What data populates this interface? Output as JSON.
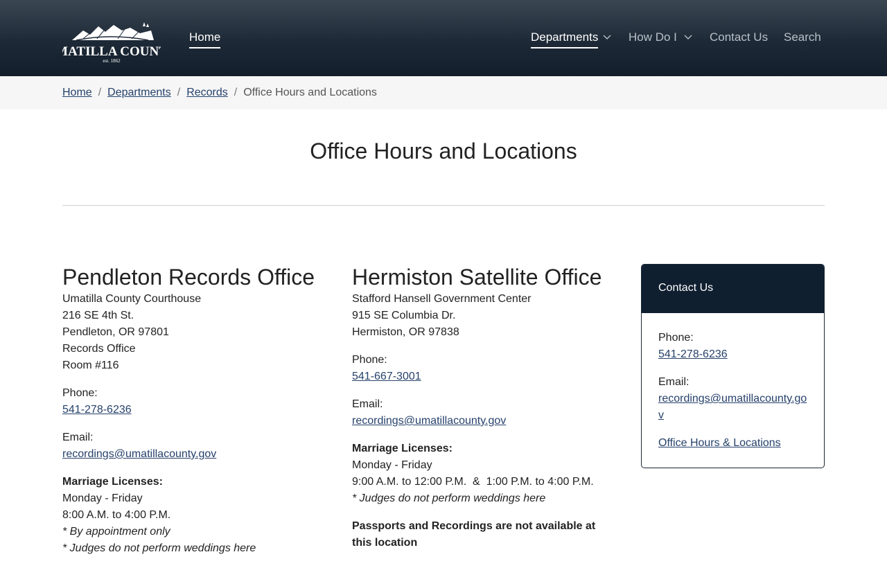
{
  "header": {
    "logo": {
      "name": "UMATILLA COUNTY",
      "est": "est. 1862"
    },
    "nav": {
      "home": "Home",
      "departments": "Departments",
      "how_do_i": "How Do I",
      "contact_us": "Contact Us",
      "search": "Search"
    }
  },
  "breadcrumb": {
    "items": [
      "Home",
      "Departments",
      "Records"
    ],
    "separator": "/",
    "current": "Office Hours and Locations"
  },
  "page": {
    "title": "Office Hours and Locations"
  },
  "pendleton": {
    "heading": "Pendleton Records Office",
    "address": [
      "Umatilla County Courthouse",
      "216 SE 4th St.",
      "Pendleton, OR 97801",
      "Records Office",
      "Room #116"
    ],
    "phone_label": "Phone:",
    "phone": "541-278-6236",
    "email_label": "Email:",
    "email": "recordings@umatillacounty.gov",
    "marriage_label": "Marriage Licenses:",
    "days": "Monday - Friday",
    "hours": "8:00 A.M. to 4:00 P.M.",
    "note1": "* By appointment only",
    "note2": "* Judges do not perform weddings here"
  },
  "hermiston": {
    "heading": "Hermiston Satellite Office",
    "address": [
      "Stafford Hansell Government Center",
      "915 SE Columbia Dr.",
      "Hermiston, OR 97838"
    ],
    "phone_label": "Phone:",
    "phone": "541-667-3001",
    "email_label": "Email:",
    "email": "recordings@umatillacounty.gov",
    "marriage_label": "Marriage Licenses:",
    "days": "Monday - Friday",
    "hours": "9:00 A.M. to 12:00 P.M.  &  1:00 P.M. to 4:00 P.M.",
    "note1": "* Judges do not perform weddings here",
    "notice": "Passports and Recordings are not available at this location"
  },
  "contact_card": {
    "title": "Contact Us",
    "phone_label": "Phone:",
    "phone": "541-278-6236",
    "email_label": "Email:",
    "email": "recordings@umatillacounty.gov",
    "link": "Office Hours & Locations"
  },
  "colors": {
    "header_dark": "#121e2b",
    "card_header": "#0f1f30",
    "link": "#26416b",
    "breadcrumb_bg": "#f6f6f6"
  }
}
